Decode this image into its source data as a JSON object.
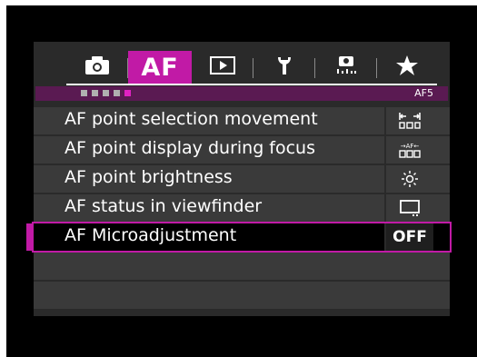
{
  "tabs": [
    {
      "name": "shooting",
      "icon": "camera-icon",
      "label": ""
    },
    {
      "name": "af",
      "icon": "",
      "label": "AF"
    },
    {
      "name": "playback",
      "icon": "play-icon",
      "label": ""
    },
    {
      "name": "setup",
      "icon": "wrench-icon",
      "label": ""
    },
    {
      "name": "custom",
      "icon": "custom-function-icon",
      "label": ""
    },
    {
      "name": "mymenu",
      "icon": "star-icon",
      "label": ""
    }
  ],
  "subbar": {
    "page_label": "AF5",
    "page_dots_total": 5,
    "active_dot": 5
  },
  "menu": {
    "items": [
      {
        "label": "AF point selection movement",
        "value_icon": "af-point-movement-icon",
        "value_text": ""
      },
      {
        "label": "AF point display during focus",
        "value_icon": "af-point-display-icon",
        "value_text": ""
      },
      {
        "label": "AF point brightness",
        "value_icon": "brightness-icon",
        "value_text": ""
      },
      {
        "label": "AF status in viewfinder",
        "value_icon": "viewfinder-icon",
        "value_text": ""
      },
      {
        "label": "AF Microadjustment",
        "value_icon": "",
        "value_text": "OFF"
      }
    ],
    "selected_index": 4
  },
  "colors": {
    "accent": "#c11aa6",
    "accent_dark": "#5a1a52",
    "panel": "#2a2a2a",
    "row": "#3a3a3a"
  }
}
